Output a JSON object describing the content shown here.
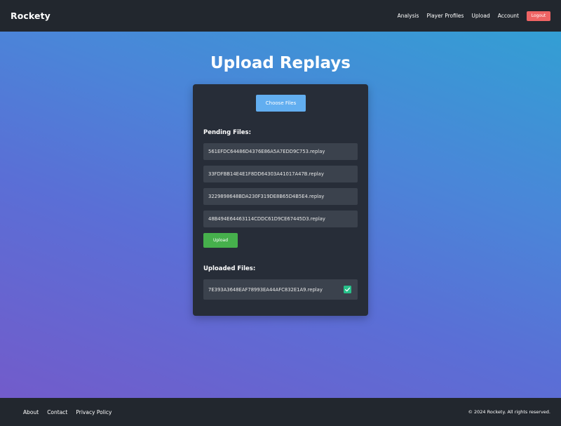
{
  "navbar": {
    "brand": "Rockety",
    "links": [
      "Analysis",
      "Player Profiles",
      "Upload",
      "Account"
    ],
    "logout_label": "Logout"
  },
  "page": {
    "title": "Upload Replays"
  },
  "card": {
    "choose_files_label": "Choose Files",
    "pending_title": "Pending Files:",
    "pending_files": [
      "561EFDC64486D4376E86A5A7EDD9C753.replay",
      "33FDFBB14E4E1F8DD64303A41017A47B.replay",
      "3229898648BDA230F319DE8B65D4B5E4.replay",
      "48B494E64463114CDDC61D9CE67445D3.replay"
    ],
    "upload_label": "Upload",
    "uploaded_title": "Uploaded Files:",
    "uploaded_files": [
      "7E393A3648EAF78993EA44AFC832E1A9.replay"
    ]
  },
  "footer": {
    "links": [
      "About",
      "Contact",
      "Privacy Policy"
    ],
    "copyright": "© 2024 Rockety. All rights reserved."
  },
  "colors": {
    "navbar_bg": "#22272e",
    "card_bg": "#272d38",
    "choose_button": "#62aef0",
    "upload_button": "#46b04c",
    "logout_button": "#ef6464",
    "check_badge": "#28c08a"
  }
}
